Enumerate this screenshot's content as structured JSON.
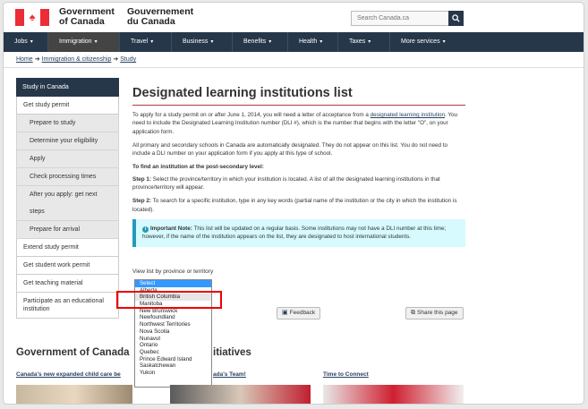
{
  "header": {
    "gov_en": [
      "Government",
      "of Canada"
    ],
    "gov_fr": [
      "Gouvernement",
      "du Canada"
    ],
    "search_placeholder": "Search Canada.ca"
  },
  "nav": [
    {
      "label": "Jobs"
    },
    {
      "label": "Immigration"
    },
    {
      "label": "Travel"
    },
    {
      "label": "Business"
    },
    {
      "label": "Benefits"
    },
    {
      "label": "Health"
    },
    {
      "label": "Taxes"
    },
    {
      "label": "More services"
    }
  ],
  "breadcrumb": [
    "Home",
    "Immigration & citizenship",
    "Study"
  ],
  "sidebar": {
    "head": "Study in Canada",
    "items": [
      {
        "label": "Get study permit",
        "sub": false
      },
      {
        "label": "Prepare to study",
        "sub": true
      },
      {
        "label": "Determine your eligibility",
        "sub": true
      },
      {
        "label": "Apply",
        "sub": true
      },
      {
        "label": "Check processing times",
        "sub": true
      },
      {
        "label": "After you apply: get next steps",
        "sub": true
      },
      {
        "label": "Prepare for arrival",
        "sub": true
      },
      {
        "label": "Extend study permit",
        "sub": false
      },
      {
        "label": "Get student work permit",
        "sub": false
      },
      {
        "label": "Get teaching material",
        "sub": false
      },
      {
        "label": "Participate as an educational institution",
        "sub": false
      }
    ]
  },
  "main": {
    "title": "Designated learning institutions list",
    "p1_a": "To apply for a study permit on or after June 1, 2014, you will need a letter of acceptance from a ",
    "p1_link": "designated learning institution",
    "p1_b": ". You need to include the Designated Learning Institution number (DLI #), which is the number that begins with the letter \"O\", on your application form.",
    "p2": "All primary and secondary schools in Canada are automatically designated. They do not appear on this list. You do not need to include a DLI number on your application form if you apply at this type of school.",
    "find_heading": "To find an institution at the post-secondary level:",
    "step1_label": "Step 1:",
    "step1_text": " Select the province/territory in which your institution is located. A list of all the designated learning institutions in that province/territory will appear.",
    "step2_label": "Step 2:",
    "step2_text": " To search for a specific institution, type in any key words (partial name of the institution or the city in which the institution is located).",
    "note_label": "Important Note:",
    "note_text": " This list will be updated on a regular basis. Some institutions may not have a DLI number at this time; however, if the name of the institution appears on the list, they are designated to host international students."
  },
  "dropdown": {
    "label": "View list by province or territory",
    "options": [
      "Select",
      "Alberta",
      "British Columbia",
      "Manitoba",
      "New Brunswick",
      "Newfoundland",
      "Northwest Territories",
      "Nova Scotia",
      "Nunavut",
      "Ontario",
      "Quebec",
      "Prince Edward Island",
      "Saskatchewan",
      "Yukon"
    ],
    "selected": "Select",
    "highlighted": "British Columbia"
  },
  "buttons": {
    "feedback": "Feedback",
    "share": "Share this page"
  },
  "bottom": {
    "title_a": "Government of Canada",
    "title_b": "itiatives",
    "feature1": "Canada's new expanded child care be",
    "feature2": "ada's Team!",
    "feature3": "Time to Connect"
  }
}
